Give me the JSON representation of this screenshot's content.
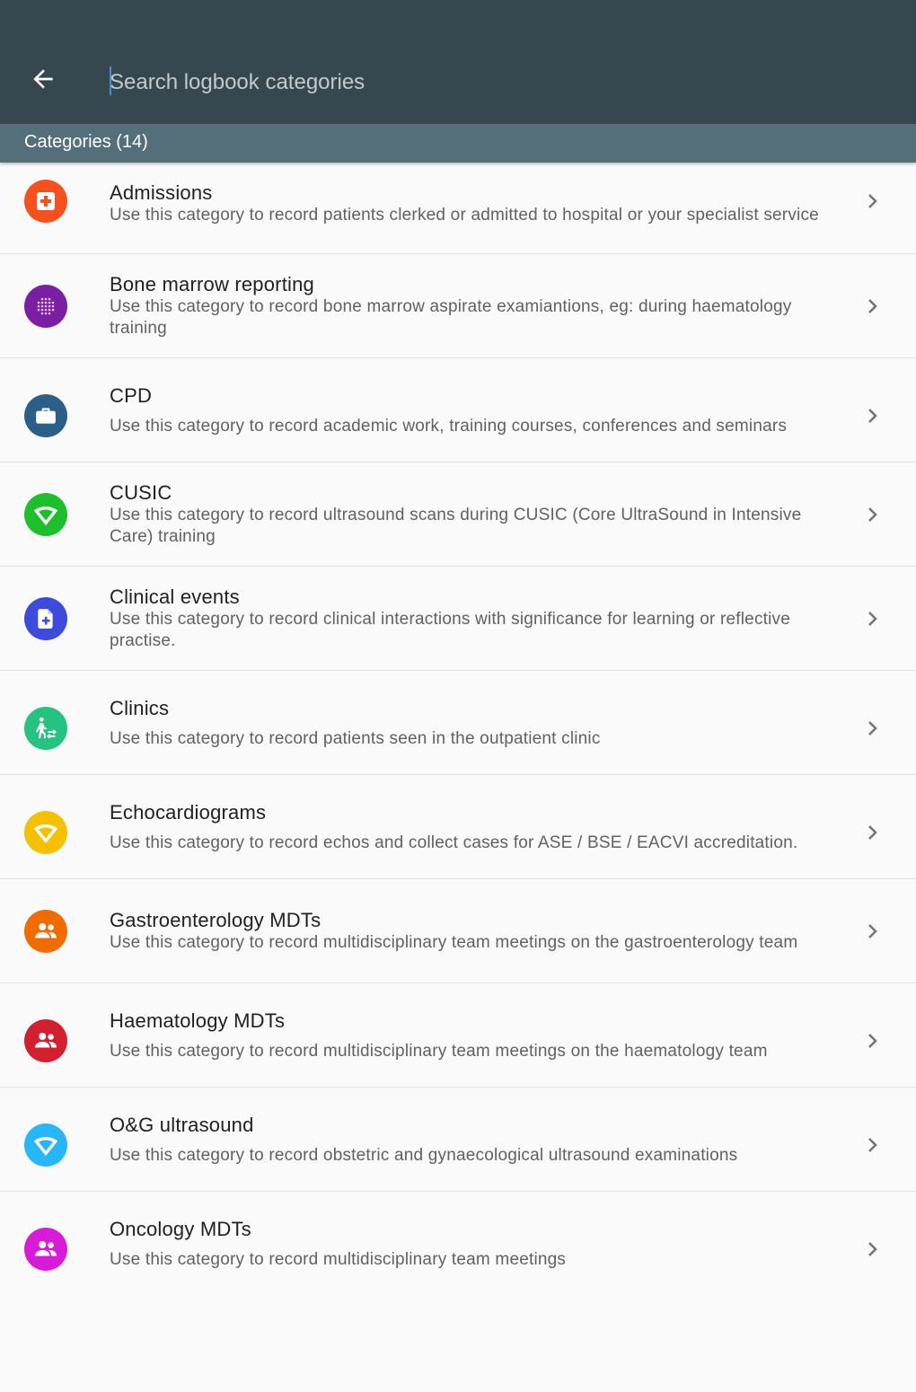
{
  "search": {
    "placeholder": "Search logbook categories",
    "value": ""
  },
  "subheader": {
    "label": "Categories (14)"
  },
  "categories": [
    {
      "title": "Admissions",
      "desc": "Use this category to record patients clerked or admitted to hospital or your specialist service",
      "icon": "medical-cross-icon",
      "color": "#f4511e"
    },
    {
      "title": "Bone marrow reporting",
      "desc": "Use this category to record bone marrow aspirate examiantions, eg: during haematology training",
      "icon": "dotted-grid-icon",
      "color": "#7b1fa2"
    },
    {
      "title": "CPD",
      "desc": "Use this category to record academic work, training courses, conferences and seminars",
      "icon": "briefcase-icon",
      "color": "#2c5f88"
    },
    {
      "title": "CUSIC",
      "desc": "Use this category to record ultrasound scans during CUSIC (Core UltraSound in Intensive Care) training",
      "icon": "ultrasound-icon",
      "color": "#1ebe2c"
    },
    {
      "title": "Clinical events",
      "desc": "Use this category to record clinical interactions with significance for learning or reflective practise.",
      "icon": "document-plus-icon",
      "color": "#3d4bdb"
    },
    {
      "title": "Clinics",
      "desc": "Use this category to record patients seen in the outpatient clinic",
      "icon": "walking-person-icon",
      "color": "#26c281"
    },
    {
      "title": "Echocardiograms",
      "desc": "Use this category to record echos and collect cases for ASE / BSE / EACVI accreditation.",
      "icon": "ultrasound-icon",
      "color": "#f5c000"
    },
    {
      "title": "Gastroenterology MDTs",
      "desc": "Use this category to record multidisciplinary team meetings on the gastroenterology team",
      "icon": "group-icon",
      "color": "#ef6c00"
    },
    {
      "title": "Haematology MDTs",
      "desc": "Use this category to record multidisciplinary team meetings on the haematology team",
      "icon": "group-icon",
      "color": "#d32030"
    },
    {
      "title": "O&G ultrasound",
      "desc": "Use this category to record obstetric and gynaecological ultrasound examinations",
      "icon": "ultrasound-icon",
      "color": "#29b6f6"
    },
    {
      "title": "Oncology MDTs",
      "desc": "Use this category to record multidisciplinary team meetings",
      "icon": "group-icon",
      "color": "#d81bd8"
    }
  ]
}
